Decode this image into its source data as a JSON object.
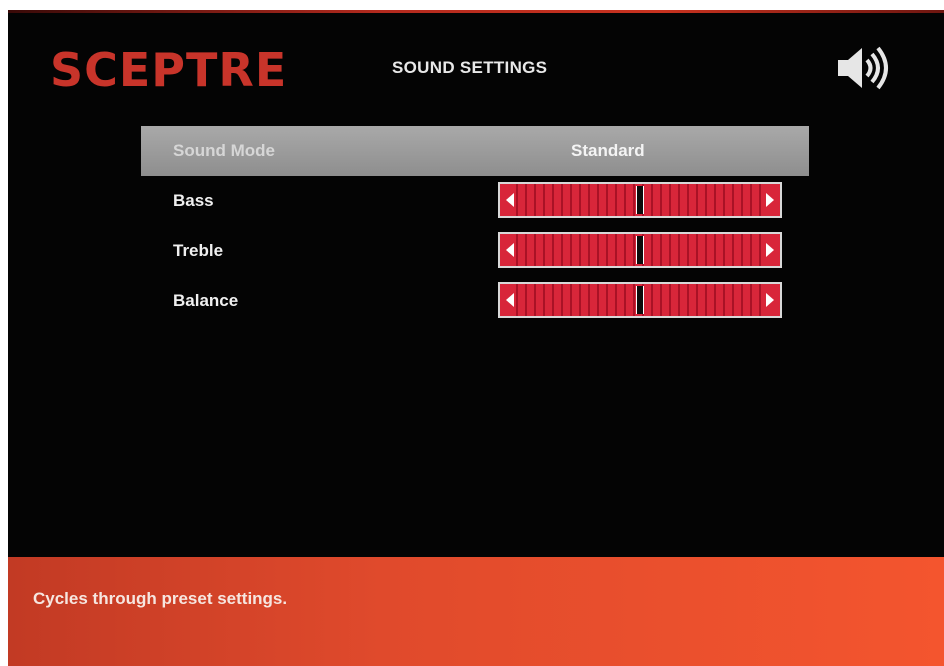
{
  "brand": {
    "logo_text": "SCEPTRE",
    "logo_color": "#c8342a"
  },
  "header": {
    "title": "SOUND SETTINGS",
    "icon": "speaker-volume-icon"
  },
  "menu": {
    "sound_mode": {
      "label": "Sound Mode",
      "value": "Standard",
      "selected": true
    },
    "bass": {
      "label": "Bass",
      "level": 0.5
    },
    "treble": {
      "label": "Treble",
      "level": 0.5
    },
    "balance": {
      "label": "Balance",
      "level": 0.5
    }
  },
  "footer": {
    "hint": "Cycles through preset settings."
  },
  "colors": {
    "slider_fill": "#d8263a",
    "footer_bg": "#e04a2c",
    "selected_row": "#9c9c9c"
  }
}
